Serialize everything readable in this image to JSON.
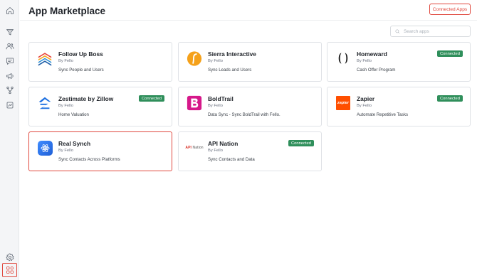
{
  "header": {
    "title": "App Marketplace",
    "connected_apps_label": "Connected Apps"
  },
  "search": {
    "placeholder": "Search apps",
    "value": ""
  },
  "sidebar": {
    "items": [
      {
        "icon": "home-icon"
      },
      {
        "icon": "funnel-icon"
      },
      {
        "icon": "users-icon"
      },
      {
        "icon": "message-icon"
      },
      {
        "icon": "megaphone-icon"
      },
      {
        "icon": "workflow-icon"
      },
      {
        "icon": "report-icon"
      },
      {
        "icon": "settings-icon"
      },
      {
        "icon": "apps-icon",
        "active": true
      }
    ]
  },
  "colors": {
    "accent": "#e0483e",
    "connected_badge": "#2f8f5b"
  },
  "apps": [
    {
      "name": "Follow Up Boss",
      "by": "By Fello",
      "description": "Sync People and Users",
      "status": ""
    },
    {
      "name": "Sierra Interactive",
      "by": "By Fello",
      "description": "Sync Leads and Users",
      "status": ""
    },
    {
      "name": "Homeward",
      "by": "By Fello",
      "description": "Cash Offer Program",
      "status": "Connected"
    },
    {
      "name": "Zestimate by Zillow",
      "by": "By Fello",
      "description": "Home Valuation",
      "status": "Connected"
    },
    {
      "name": "BoldTrail",
      "by": "By Fello",
      "description": "Data Sync - Sync BoldTrail with Fello.",
      "status": ""
    },
    {
      "name": "Zapier",
      "by": "By Fello",
      "description": "Automate Repetitive Tasks",
      "status": "Connected",
      "logo_text": "zapier"
    },
    {
      "name": "Real Synch",
      "by": "By Fello",
      "description": "Sync Contacts Across Platforms",
      "status": "",
      "selected": true
    },
    {
      "name": "API Nation",
      "by": "By Fello",
      "description": "Sync Contacts and Data",
      "status": "Connected",
      "logo_text_a": "API",
      "logo_text_b": " Nation"
    }
  ]
}
